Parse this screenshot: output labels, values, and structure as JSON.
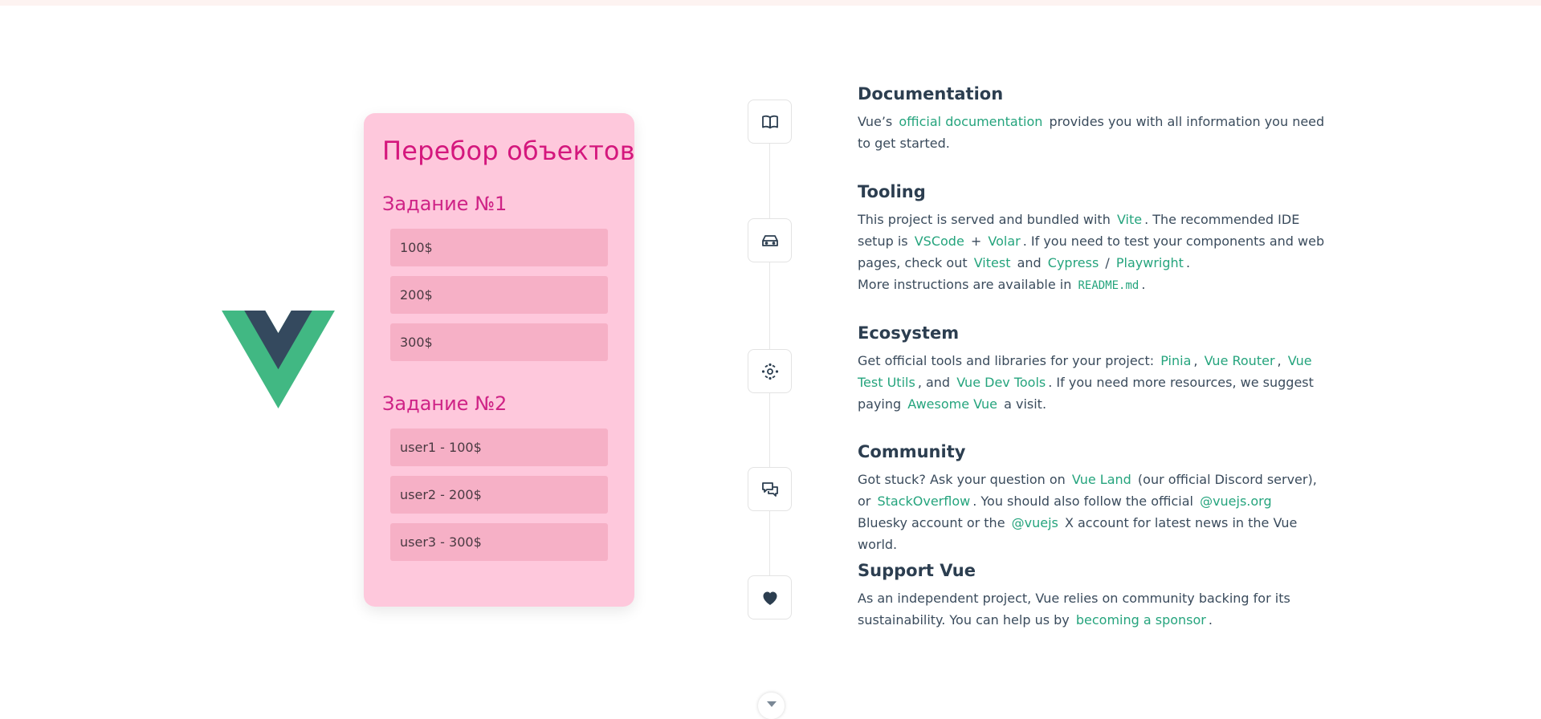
{
  "card": {
    "title": "Перебор объектов",
    "task1": {
      "title": "Задание №1",
      "items": [
        "100$",
        "200$",
        "300$"
      ]
    },
    "task2": {
      "title": "Задание №2",
      "items": [
        "user1 - 100$",
        "user2 - 200$",
        "user3 - 300$"
      ]
    }
  },
  "colors": {
    "accent": "#25a47d",
    "vue_green": "#41b883",
    "vue_dark": "#34495e",
    "card_bg": "#fec8dc",
    "card_title": "#d4177d"
  },
  "icons": [
    "book-icon",
    "tooling-icon",
    "ecosystem-icon",
    "community-icon",
    "heart-icon"
  ],
  "items": {
    "documentation": {
      "title": "Documentation",
      "t1": "Vue’s",
      "link": "official documentation",
      "t2": "provides you with all information you need to get started."
    },
    "tooling": {
      "title": "Tooling",
      "t1": "This project is served and bundled with",
      "vite": "Vite",
      "t2": ". The recommended IDE setup is",
      "vscode": "VSCode",
      "plus": "+",
      "volar": "Volar",
      "t3": ". If you need to test your components and web pages, check out",
      "vitest": "Vitest",
      "and": "and",
      "cypress": "Cypress",
      "slash": "/",
      "playwright": "Playwright",
      "dot": ".",
      "t4": "More instructions are available in",
      "readme": "README.md",
      "dot2": "."
    },
    "ecosystem": {
      "title": "Ecosystem",
      "t1": "Get official tools and libraries for your project:",
      "pinia": "Pinia",
      "comma1": ",",
      "router": "Vue Router",
      "comma2": ",",
      "testutils": "Vue Test Utils",
      "t2": ", and",
      "devtools": "Vue Dev Tools",
      "t3": ". If you need more resources, we suggest paying",
      "awesome": "Awesome Vue",
      "t4": "a visit."
    },
    "community": {
      "title": "Community",
      "t1": "Got stuck? Ask your question on",
      "vueland": "Vue Land",
      "t2": "(our official Discord server), or",
      "stackoverflow": "StackOverflow",
      "t3": ". You should also follow the official",
      "bluesky": "@vuejs.org",
      "t4": "Bluesky account or the",
      "x": "@vuejs",
      "t5": "X account for latest news in the Vue world."
    },
    "support": {
      "title": "Support Vue",
      "t1": "As an independent project, Vue relies on community backing for its sustainability. You can help us by",
      "sponsor": "becoming a sponsor",
      "dot": "."
    }
  }
}
